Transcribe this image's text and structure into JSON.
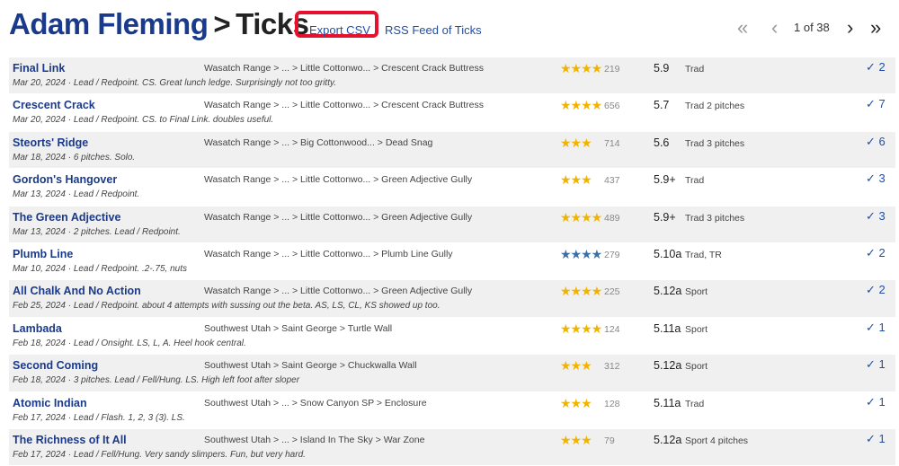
{
  "header": {
    "name": "Adam Fleming",
    "separator": ">",
    "section": "Ticks",
    "export_label": "Export CSV",
    "dot": "·",
    "rss_label": "RSS Feed of Ticks",
    "highlight_color": "#e8112d"
  },
  "pager": {
    "first": "«",
    "prev": "‹",
    "label": "1 of 38",
    "next": "›",
    "last": "»"
  },
  "colors": {
    "link": "#1a3a8c",
    "star": "#f0b400",
    "star_alt": "#3a6fa8",
    "row_alt": "#f0f0f0"
  },
  "ticks": [
    {
      "route": "Final Link",
      "note": "Mar 20, 2024 · Lead / Redpoint. CS. Great lunch ledge. Surprisingly not too gritty.",
      "loc": "Wasatch Range > ... > Little Cottonwo... > Crescent Crack Buttress",
      "stars": "★★★★",
      "votes": "219",
      "grade": "5.9",
      "type": "Trad",
      "check": "✓ 2"
    },
    {
      "route": "Crescent Crack",
      "note": "Mar 20, 2024 · Lead / Redpoint. CS. to Final Link. doubles useful.",
      "loc": "Wasatch Range > ... > Little Cottonwo... > Crescent Crack Buttress",
      "stars": "★★★★",
      "votes": "656",
      "grade": "5.7",
      "type": "Trad 2 pitches",
      "check": "✓ 7"
    },
    {
      "route": "Steorts' Ridge",
      "note": "Mar 18, 2024 · 6 pitches. Solo.",
      "loc": "Wasatch Range > ... > Big Cottonwood... > Dead Snag",
      "stars": "★★★",
      "votes": "714",
      "grade": "5.6",
      "type": "Trad 3 pitches",
      "check": "✓ 6"
    },
    {
      "route": "Gordon's Hangover",
      "note": "Mar 13, 2024 · Lead / Redpoint.",
      "loc": "Wasatch Range > ... > Little Cottonwo... > Green Adjective Gully",
      "stars": "★★★",
      "votes": "437",
      "grade": "5.9+",
      "type": "Trad",
      "check": "✓ 3"
    },
    {
      "route": "The Green Adjective",
      "note": "Mar 13, 2024 · 2 pitches. Lead / Redpoint.",
      "loc": "Wasatch Range > ... > Little Cottonwo... > Green Adjective Gully",
      "stars": "★★★★",
      "votes": "489",
      "grade": "5.9+",
      "type": "Trad 3 pitches",
      "check": "✓ 3"
    },
    {
      "route": "Plumb Line",
      "note": "Mar 10, 2024 · Lead / Redpoint. .2-.75, nuts",
      "loc": "Wasatch Range > ... > Little Cottonwo... > Plumb Line Gully",
      "stars": "★★★★",
      "votes": "279",
      "grade": "5.10a",
      "type": "Trad, TR",
      "check": "✓ 2",
      "blue": true
    },
    {
      "route": "All Chalk And No Action",
      "note": "Feb 25, 2024 · Lead / Redpoint. about 4 attempts with sussing out the beta. AS, LS, CL, KS showed up too.",
      "loc": "Wasatch Range > ... > Little Cottonwo... > Green Adjective Gully",
      "stars": "★★★★",
      "votes": "225",
      "grade": "5.12a",
      "type": "Sport",
      "check": "✓ 2"
    },
    {
      "route": "Lambada",
      "note": "Feb 18, 2024 · Lead / Onsight. LS, L, A. Heel hook central.",
      "loc": "Southwest Utah > Saint George > Turtle Wall",
      "stars": "★★★★",
      "votes": "124",
      "grade": "5.11a",
      "type": "Sport",
      "check": "✓ 1"
    },
    {
      "route": "Second Coming",
      "note": "Feb 18, 2024 · 3 pitches. Lead / Fell/Hung. LS. High left foot after sloper",
      "loc": "Southwest Utah > Saint George > Chuckwalla Wall",
      "stars": "★★★",
      "votes": "312",
      "grade": "5.12a",
      "type": "Sport",
      "check": "✓ 1"
    },
    {
      "route": "Atomic Indian",
      "note": "Feb 17, 2024 · Lead / Flash. 1, 2, 3 (3). LS.",
      "loc": "Southwest Utah > ... > Snow Canyon SP > Enclosure",
      "stars": "★★★",
      "votes": "128",
      "grade": "5.11a",
      "type": "Trad",
      "check": "✓ 1"
    },
    {
      "route": "The Richness of It All",
      "note": "Feb 17, 2024 · Lead / Fell/Hung. Very sandy slimpers. Fun, but very hard.",
      "loc": "Southwest Utah > ... > Island In The Sky > War Zone",
      "stars": "★★★",
      "votes": "79",
      "grade": "5.12a",
      "type": "Sport 4 pitches",
      "check": "✓ 1"
    }
  ]
}
